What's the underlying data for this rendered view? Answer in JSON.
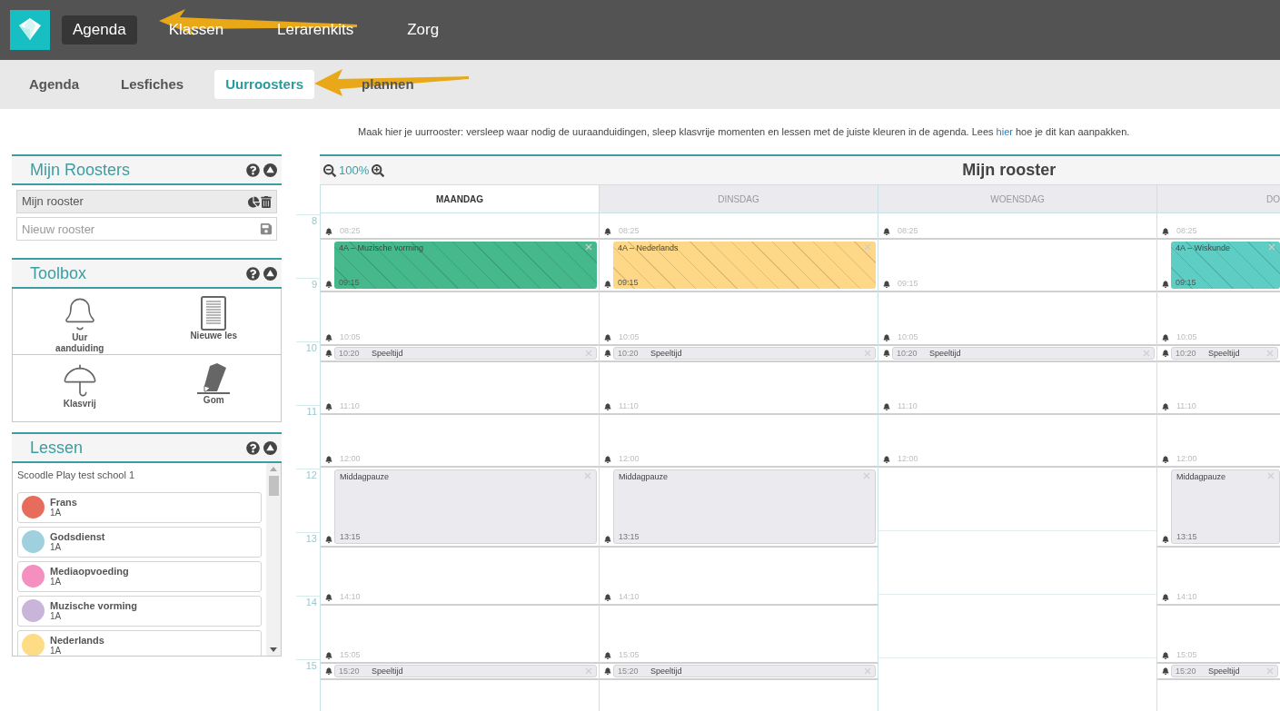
{
  "topnav": {
    "items": [
      {
        "label": "Agenda",
        "selected": true
      },
      {
        "label": "Klassen",
        "selected": false
      },
      {
        "label": "Lerarenkits",
        "selected": false
      },
      {
        "label": "Zorg",
        "selected": false
      }
    ]
  },
  "subnav": {
    "items": [
      {
        "label": "Agenda",
        "selected": false
      },
      {
        "label": "Lesfiches",
        "selected": false
      },
      {
        "label": "Uurroosters",
        "selected": true
      },
      {
        "label": "plannen",
        "selected": false
      }
    ]
  },
  "instruction": {
    "before": "Maak hier je uurrooster: versleep waar nodig de uuraanduidingen, sleep klasvrije momenten en lessen met de juiste kleuren in de agenda. Lees",
    "link": "hier",
    "after": "hoe je dit kan aanpakken."
  },
  "roosters": {
    "title": "Mijn Roosters",
    "items": [
      "Mijn rooster"
    ],
    "new_placeholder": "Nieuw rooster"
  },
  "toolbox": {
    "title": "Toolbox",
    "tools": [
      {
        "kind": "bell",
        "label": "Uur aanduiding"
      },
      {
        "kind": "document",
        "label": "Nieuwe les"
      },
      {
        "kind": "umbrella",
        "label": "Klasvrij"
      },
      {
        "kind": "eraser",
        "label": "Gom"
      }
    ]
  },
  "lessen": {
    "title": "Lessen",
    "school": "Scoodle Play test school 1",
    "items": [
      {
        "name": "Frans",
        "class": "1A",
        "color": "#e86c5c"
      },
      {
        "name": "Godsdienst",
        "class": "1A",
        "color": "#9fd0de"
      },
      {
        "name": "Mediaopvoeding",
        "class": "1A",
        "color": "#f48fc0"
      },
      {
        "name": "Muzische vorming",
        "class": "1A",
        "color": "#c9b5d9"
      },
      {
        "name": "Nederlands",
        "class": "1A",
        "color": "#fedb85"
      }
    ]
  },
  "calendar": {
    "zoom": "100%",
    "title": "Mijn rooster",
    "hours": [
      "8",
      "9",
      "10",
      "11",
      "12",
      "13",
      "14",
      "15"
    ],
    "days": [
      {
        "name": "MAANDAG",
        "selected": true,
        "slots": [
          {
            "kind": "bell",
            "time": "08:25"
          },
          {
            "kind": "lesson",
            "title": "4A – Muzische vorming",
            "time": "09:15",
            "color": "#45b98c"
          },
          {
            "kind": "bell",
            "time": "10:05"
          },
          {
            "kind": "break",
            "title": "Speeltijd",
            "time": "10:20"
          },
          {
            "kind": "bell",
            "time": "11:10"
          },
          {
            "kind": "bell",
            "time": "12:00"
          },
          {
            "kind": "pause",
            "title": "Middagpauze",
            "time": "13:15"
          },
          {
            "kind": "bell",
            "time": "14:10"
          },
          {
            "kind": "bell",
            "time": "15:05"
          },
          {
            "kind": "break",
            "title": "Speeltijd",
            "time": "15:20"
          },
          {
            "kind": "free"
          }
        ]
      },
      {
        "name": "DINSDAG",
        "selected": false,
        "slots": [
          {
            "kind": "bell",
            "time": "08:25"
          },
          {
            "kind": "lesson",
            "title": "4A – Nederlands",
            "time": "09:15",
            "color": "#fed886"
          },
          {
            "kind": "bell",
            "time": "10:05"
          },
          {
            "kind": "break",
            "title": "Speeltijd",
            "time": "10:20"
          },
          {
            "kind": "bell",
            "time": "11:10"
          },
          {
            "kind": "bell",
            "time": "12:00"
          },
          {
            "kind": "pause",
            "title": "Middagpauze",
            "time": "13:15"
          },
          {
            "kind": "bell",
            "time": "14:10"
          },
          {
            "kind": "bell",
            "time": "15:05"
          },
          {
            "kind": "break",
            "title": "Speeltijd",
            "time": "15:20"
          },
          {
            "kind": "free"
          }
        ]
      },
      {
        "name": "WOENSDAG",
        "selected": false,
        "slots": [
          {
            "kind": "bell",
            "time": "08:25"
          },
          {
            "kind": "bell",
            "time": "09:15"
          },
          {
            "kind": "bell",
            "time": "10:05"
          },
          {
            "kind": "break",
            "title": "Speeltijd",
            "time": "10:20"
          },
          {
            "kind": "bell",
            "time": "11:10"
          },
          {
            "kind": "bell",
            "time": "12:00"
          },
          {
            "kind": "empty"
          },
          {
            "kind": "empty"
          },
          {
            "kind": "empty"
          },
          {
            "kind": "empty"
          }
        ]
      },
      {
        "name": "DO",
        "selected": false,
        "slots": [
          {
            "kind": "bell",
            "time": "08:25"
          },
          {
            "kind": "lesson",
            "title": "4A – Wiskunde",
            "time": "09:15",
            "color": "#5ecdc4"
          },
          {
            "kind": "bell",
            "time": "10:05"
          },
          {
            "kind": "break",
            "title": "Speeltijd",
            "time": "10:20"
          },
          {
            "kind": "bell",
            "time": "11:10"
          },
          {
            "kind": "bell",
            "time": "12:00"
          },
          {
            "kind": "pause",
            "title": "Middagpauze",
            "time": "13:15"
          },
          {
            "kind": "bell",
            "time": "14:10"
          },
          {
            "kind": "bell",
            "time": "15:05"
          },
          {
            "kind": "break",
            "title": "Speeltijd",
            "time": "15:20"
          },
          {
            "kind": "free"
          }
        ]
      }
    ]
  }
}
